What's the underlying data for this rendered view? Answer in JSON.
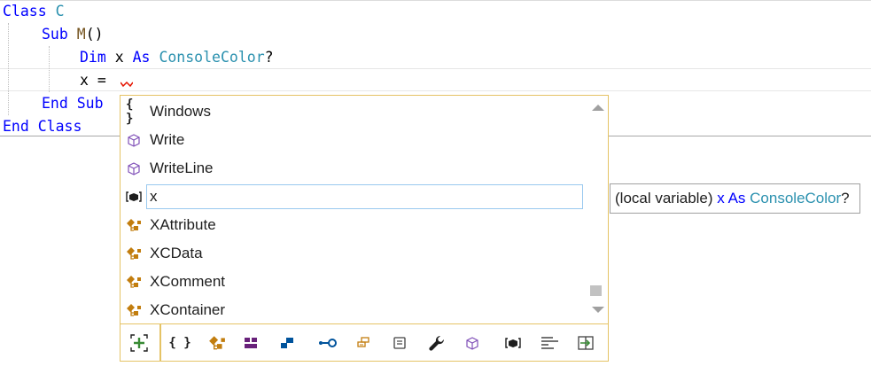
{
  "code": {
    "line1": {
      "kw": "Class",
      "name": "C"
    },
    "line2": {
      "kw": "Sub",
      "name": "M",
      "parens": "()"
    },
    "line3": {
      "kw": "Dim",
      "var": "x",
      "as": "As",
      "type": "ConsoleColor",
      "suffix": "?"
    },
    "line4": {
      "text": "x ="
    },
    "line5": {
      "text": "End Sub"
    },
    "line6": {
      "text": "End Class"
    }
  },
  "completion": {
    "items": [
      {
        "label": "Windows",
        "icon": "namespace-icon"
      },
      {
        "label": "Write",
        "icon": "method-icon"
      },
      {
        "label": "WriteLine",
        "icon": "method-icon"
      },
      {
        "label": "x",
        "icon": "local-variable-icon",
        "selected": true
      },
      {
        "label": "XAttribute",
        "icon": "class-icon"
      },
      {
        "label": "XCData",
        "icon": "class-icon"
      },
      {
        "label": "XComment",
        "icon": "class-icon"
      },
      {
        "label": "XContainer",
        "icon": "class-icon"
      }
    ],
    "filters": [
      {
        "icon": "expander-icon",
        "symbol": "[+]"
      },
      {
        "icon": "namespace-filter-icon",
        "symbol": "{ }"
      },
      {
        "icon": "class-filter-icon"
      },
      {
        "icon": "module-filter-icon"
      },
      {
        "icon": "structure-filter-icon"
      },
      {
        "icon": "interface-filter-icon"
      },
      {
        "icon": "delegate-filter-icon"
      },
      {
        "icon": "enum-filter-icon"
      },
      {
        "icon": "extension-method-filter-icon"
      },
      {
        "icon": "method-filter-icon"
      },
      {
        "icon": "local-variable-filter-icon"
      },
      {
        "icon": "keyword-filter-icon"
      },
      {
        "icon": "snippet-filter-icon"
      }
    ]
  },
  "tooltip": {
    "prefix": "(local variable)",
    "var": "x",
    "as": "As",
    "type": "ConsoleColor",
    "suffix": "?"
  },
  "colors": {
    "keyword": "#0000ff",
    "type": "#2b91af",
    "method": "#74531f",
    "popup_border": "#e5c365",
    "selection_border": "#99c9ef"
  }
}
